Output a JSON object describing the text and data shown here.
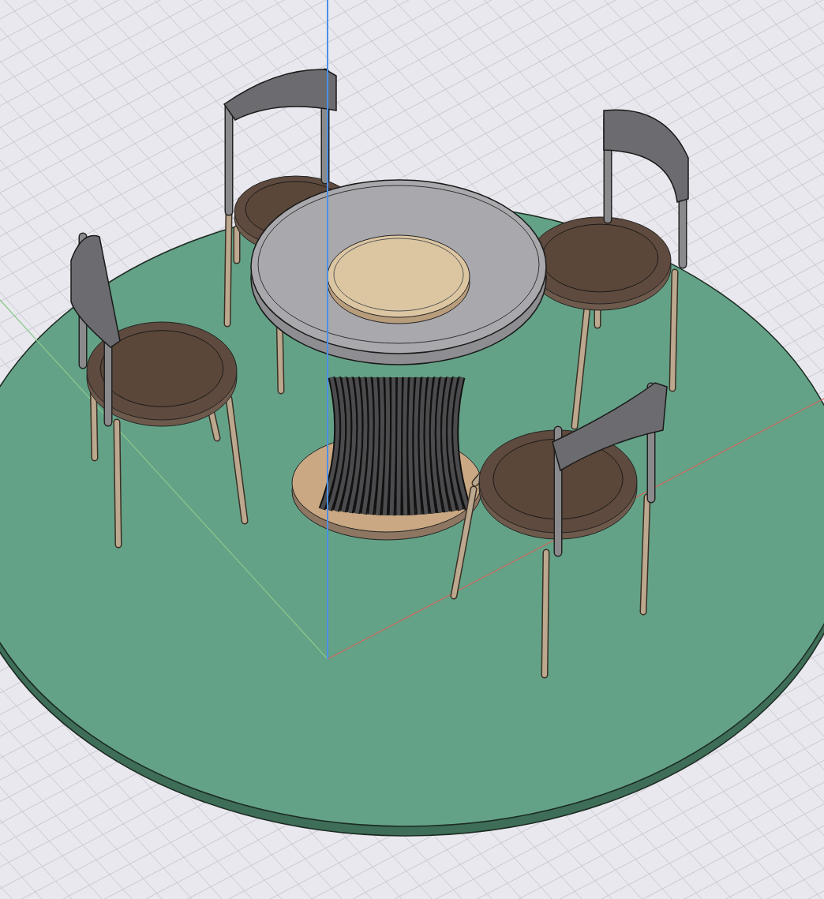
{
  "viewport": {
    "axes": [
      {
        "kind": "x",
        "color": "#d0665f"
      },
      {
        "kind": "y",
        "color": "#8cc98c"
      },
      {
        "kind": "z",
        "color": "#4d8fe8"
      }
    ]
  }
}
